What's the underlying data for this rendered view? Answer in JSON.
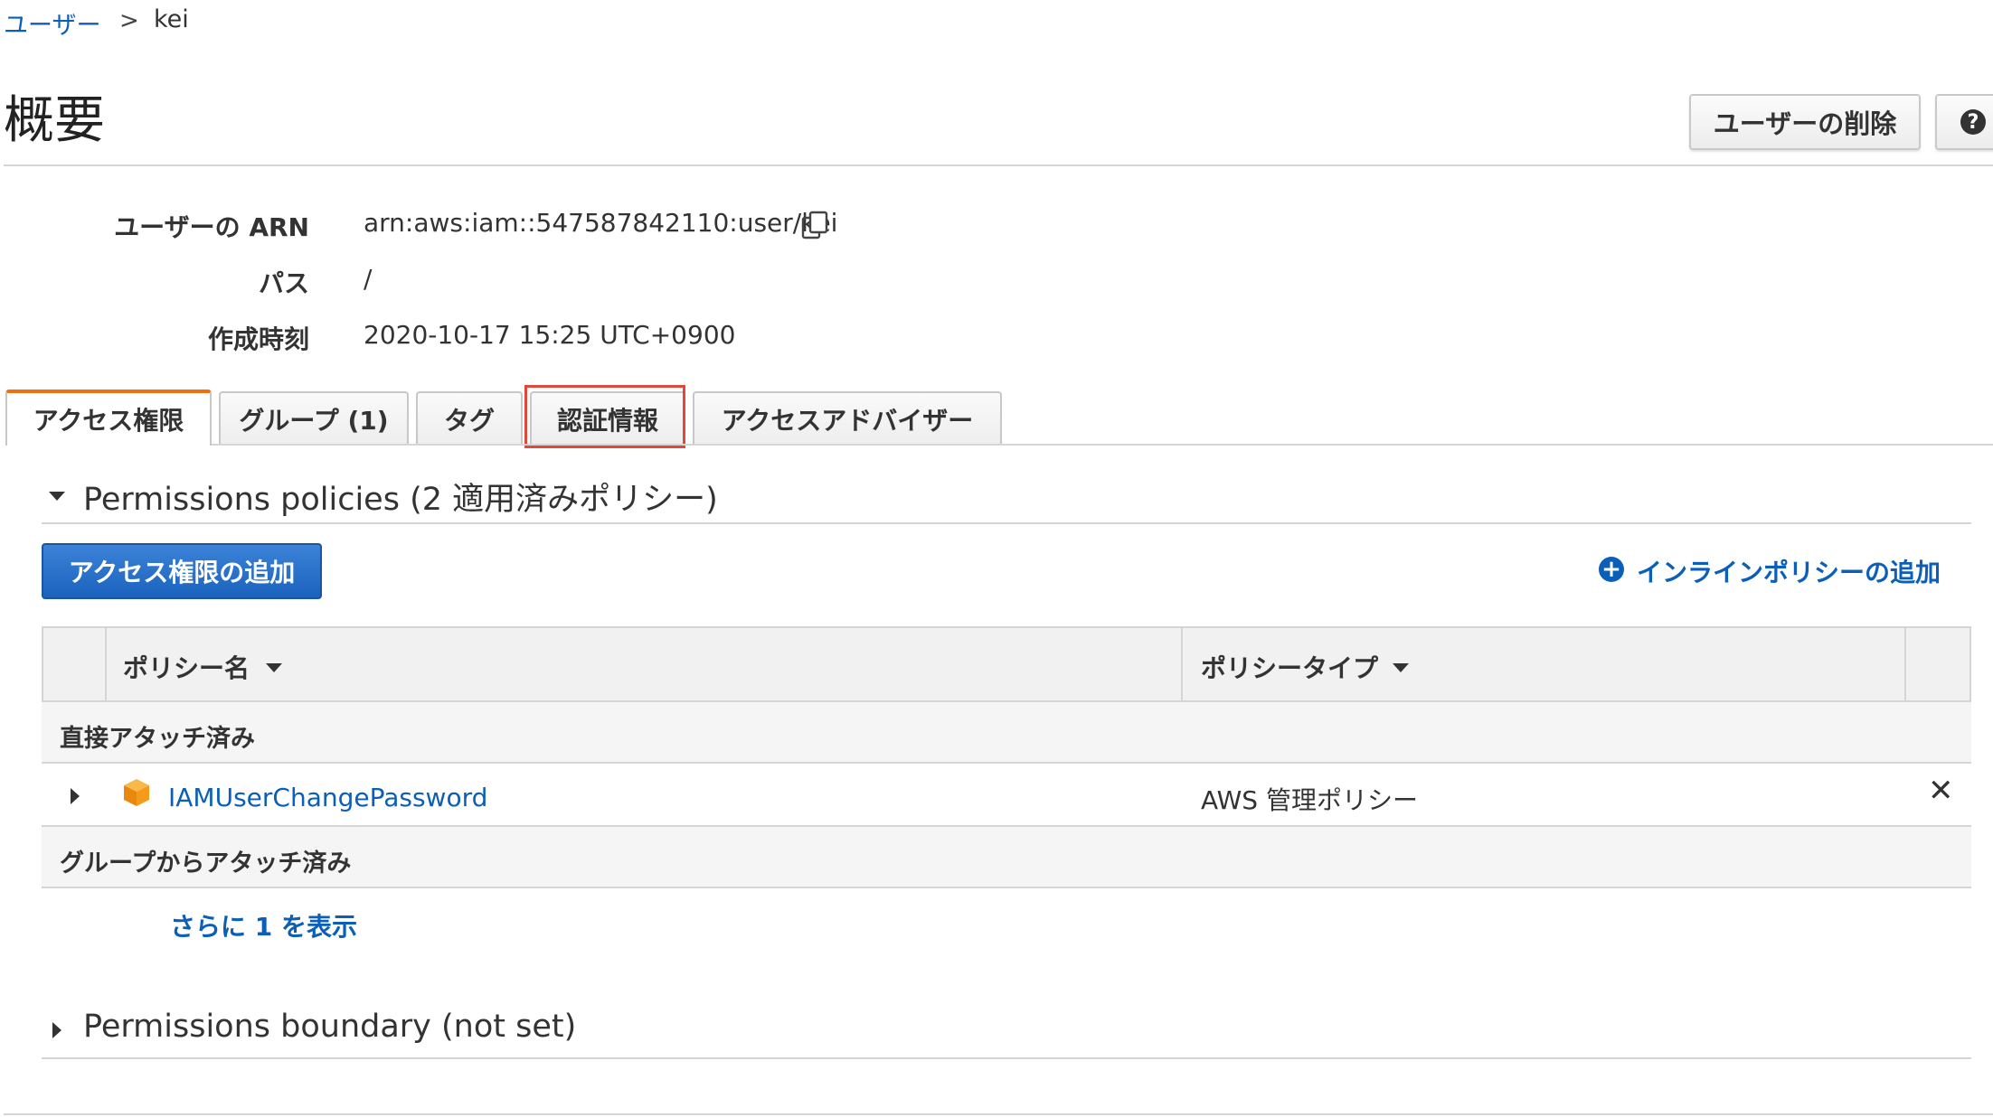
{
  "breadcrumb": {
    "parent": "ユーザー",
    "separator": ">",
    "current": "kei"
  },
  "page_title": "概要",
  "header_buttons": {
    "delete_user": "ユーザーの削除",
    "help": "?"
  },
  "summary": {
    "arn_label": "ユーザーの ARN",
    "arn_value": "arn:aws:iam::547587842110:user/kei",
    "path_label": "パス",
    "path_value": "/",
    "created_label": "作成時刻",
    "created_value": "2020-10-17 15:25 UTC+0900"
  },
  "tabs": [
    {
      "label": "アクセス権限",
      "active": true
    },
    {
      "label": "グループ (1)",
      "active": false
    },
    {
      "label": "タグ",
      "active": false
    },
    {
      "label": "認証情報",
      "active": false,
      "highlighted": true
    },
    {
      "label": "アクセスアドバイザー",
      "active": false
    }
  ],
  "permissions": {
    "section_title": "Permissions policies (2 適用済みポリシー)",
    "add_permissions_button": "アクセス権限の追加",
    "add_inline_policy": "インラインポリシーの追加",
    "columns": {
      "policy_name": "ポリシー名",
      "policy_type": "ポリシータイプ"
    },
    "group_direct": "直接アタッチ済み",
    "rows": [
      {
        "name": "IAMUserChangePassword",
        "type": "AWS 管理ポリシー"
      }
    ],
    "group_from_groups": "グループからアタッチ済み",
    "show_more": "さらに 1 を表示"
  },
  "boundary": {
    "section_title": "Permissions boundary (not set)"
  },
  "colors": {
    "link": "#0b5fb8",
    "primary_button": "#1b62bd",
    "active_tab_accent": "#ec7211",
    "highlight_border": "#e0493a",
    "policy_icon": "#f59a1a"
  }
}
